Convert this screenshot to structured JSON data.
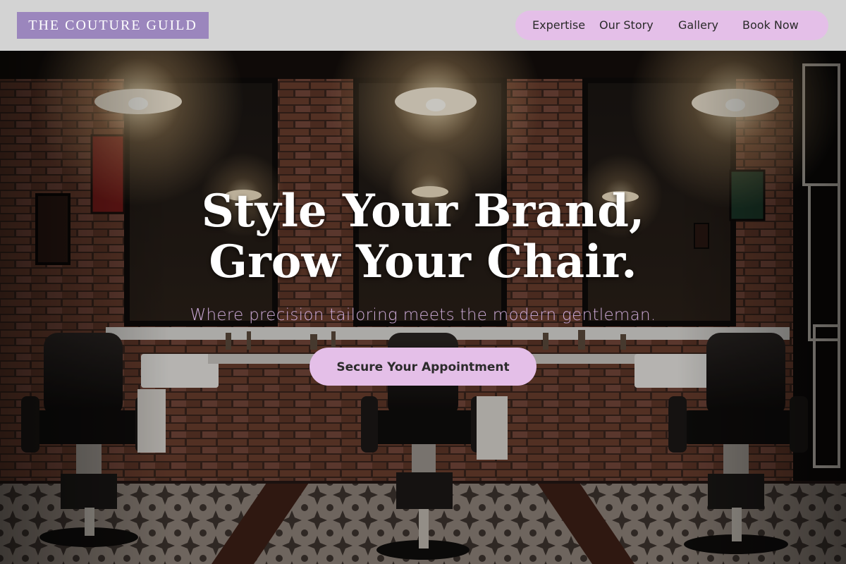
{
  "header": {
    "logo": "THE COUTURE GUILD",
    "nav": {
      "expertise": "Expertise",
      "our_story": "Our Story",
      "gallery": "Gallery",
      "book_now": "Book Now"
    }
  },
  "hero": {
    "headline_line1": "Style Your Brand,",
    "headline_line2": "Grow Your Chair.",
    "subtitle": "Where precision tailoring meets the modern gentleman.",
    "cta": "Secure Your Appointment",
    "background_description_icon": "barbershop-photo"
  },
  "colors": {
    "header_bg": "#d3d3d3",
    "logo_bg": "#9b86bd",
    "nav_bg": "#e4bfe8",
    "cta_bg": "#e4bfe8",
    "subtitle": "#cba9d6"
  }
}
